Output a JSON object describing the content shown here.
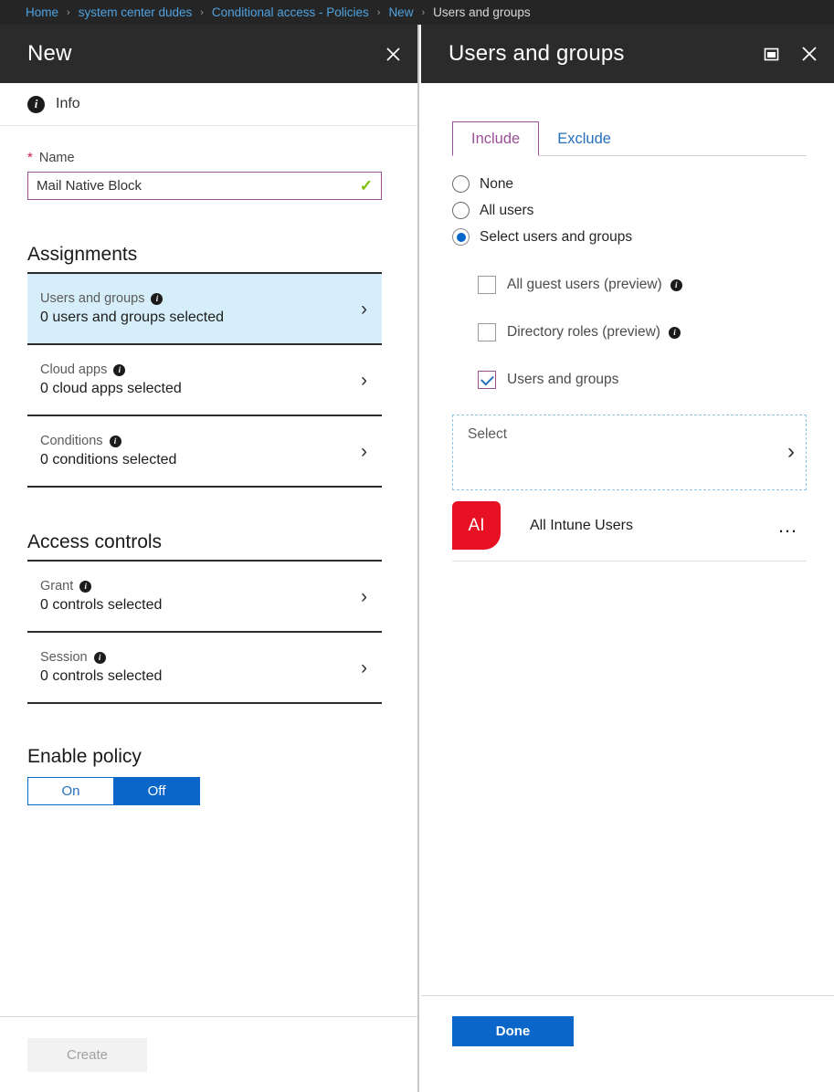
{
  "breadcrumb": {
    "separator": "›",
    "items": [
      {
        "label": "Home",
        "current": false
      },
      {
        "label": "system center dudes",
        "current": false
      },
      {
        "label": "Conditional access - Policies",
        "current": false
      },
      {
        "label": "New",
        "current": false
      },
      {
        "label": "Users and groups",
        "current": true
      }
    ]
  },
  "colors": {
    "accent_blue": "#0a66c8",
    "link_blue": "#4ea3e0",
    "purple": "#9b4f96",
    "red_avatar": "#e81123",
    "green_check": "#7cbb00",
    "selected_row": "#d6eef9",
    "header_dark": "#2b2b2b"
  },
  "left_panel": {
    "title": "New",
    "close_icon": "close-icon",
    "info_bar": {
      "icon": "info-icon",
      "label": "Info"
    },
    "name_field": {
      "label": "Name",
      "required_marker": "*",
      "value": "Mail Native Block",
      "placeholder": "",
      "valid_icon": "checkmark-icon"
    },
    "assignments": {
      "heading": "Assignments",
      "rows": [
        {
          "title": "Users and groups",
          "subtitle": "0 users and groups selected",
          "info_icon": "info-icon",
          "chevron": "chevron-right-icon",
          "selected": true
        },
        {
          "title": "Cloud apps",
          "subtitle": "0 cloud apps selected",
          "info_icon": "info-icon",
          "chevron": "chevron-right-icon",
          "selected": false
        },
        {
          "title": "Conditions",
          "subtitle": "0 conditions selected",
          "info_icon": "info-icon",
          "chevron": "chevron-right-icon",
          "selected": false
        }
      ]
    },
    "access_controls": {
      "heading": "Access controls",
      "rows": [
        {
          "title": "Grant",
          "subtitle": "0 controls selected",
          "info_icon": "info-icon",
          "chevron": "chevron-right-icon",
          "selected": false
        },
        {
          "title": "Session",
          "subtitle": "0 controls selected",
          "info_icon": "info-icon",
          "chevron": "chevron-right-icon",
          "selected": false
        }
      ]
    },
    "enable_policy": {
      "heading": "Enable policy",
      "on_label": "On",
      "off_label": "Off",
      "selected": "Off"
    },
    "footer": {
      "create_label": "Create",
      "create_disabled": true
    }
  },
  "right_panel": {
    "title": "Users and groups",
    "maximize_icon": "maximize-icon",
    "close_icon": "close-icon",
    "tabs": [
      {
        "label": "Include",
        "active": true
      },
      {
        "label": "Exclude",
        "active": false
      }
    ],
    "radios": [
      {
        "label": "None",
        "checked": false
      },
      {
        "label": "All users",
        "checked": false
      },
      {
        "label": "Select users and groups",
        "checked": true
      }
    ],
    "checkboxes": [
      {
        "label": "All guest users (preview)",
        "checked": false,
        "info_icon": "info-icon"
      },
      {
        "label": "Directory roles (preview)",
        "checked": false,
        "info_icon": "info-icon"
      },
      {
        "label": "Users and groups",
        "checked": true,
        "info_icon": ""
      }
    ],
    "select_box": {
      "placeholder": "Select",
      "chevron": "chevron-right-icon"
    },
    "selected_groups": [
      {
        "name": "All Intune Users",
        "initials": "AI",
        "menu_icon": "ellipsis-icon"
      }
    ],
    "footer": {
      "done_label": "Done"
    }
  }
}
